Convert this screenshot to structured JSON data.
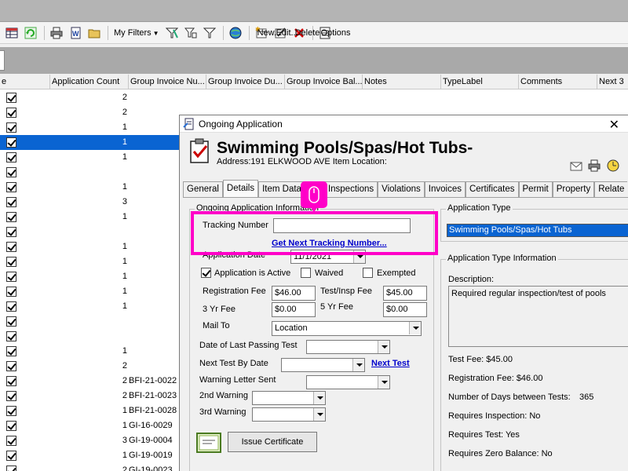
{
  "toolbar": {
    "my_filters": "My Filters",
    "new": "New...",
    "edit": "Edit...",
    "delete": "Delete",
    "options": "Options"
  },
  "grid": {
    "columns": [
      "e",
      "Application Count",
      "Group Invoice Nu...",
      "Group Invoice Du...",
      "Group Invoice Bal...",
      "Notes",
      "TypeLabel",
      "Comments",
      "Next 3"
    ],
    "rows": [
      {
        "count": "2",
        "invoice": "",
        "selected": false
      },
      {
        "count": "2",
        "invoice": "",
        "selected": false
      },
      {
        "count": "1",
        "invoice": "",
        "selected": false
      },
      {
        "count": "1",
        "invoice": "",
        "selected": true
      },
      {
        "count": "1",
        "invoice": "",
        "selected": false
      },
      {
        "count": "",
        "invoice": "",
        "selected": false
      },
      {
        "count": "1",
        "invoice": "",
        "selected": false
      },
      {
        "count": "3",
        "invoice": "",
        "selected": false
      },
      {
        "count": "1",
        "invoice": "",
        "selected": false
      },
      {
        "count": "",
        "invoice": "",
        "selected": false
      },
      {
        "count": "1",
        "invoice": "",
        "selected": false
      },
      {
        "count": "1",
        "invoice": "",
        "selected": false
      },
      {
        "count": "1",
        "invoice": "",
        "selected": false
      },
      {
        "count": "1",
        "invoice": "",
        "selected": false
      },
      {
        "count": "1",
        "invoice": "",
        "selected": false
      },
      {
        "count": "",
        "invoice": "",
        "selected": false
      },
      {
        "count": "",
        "invoice": "",
        "selected": false
      },
      {
        "count": "1",
        "invoice": "",
        "selected": false
      },
      {
        "count": "2",
        "invoice": "",
        "selected": false
      },
      {
        "count": "2",
        "invoice": "BFI-21-0022",
        "selected": false
      },
      {
        "count": "2",
        "invoice": "BFI-21-0023",
        "selected": false
      },
      {
        "count": "1",
        "invoice": "BFI-21-0028",
        "selected": false
      },
      {
        "count": "1",
        "invoice": "GI-16-0029",
        "selected": false
      },
      {
        "count": "3",
        "invoice": "GI-19-0004",
        "selected": false
      },
      {
        "count": "1",
        "invoice": "GI-19-0019",
        "selected": false
      },
      {
        "count": "2",
        "invoice": "GI-19-0023",
        "selected": false
      }
    ]
  },
  "dialog": {
    "window_title": "Ongoing Application",
    "heading": "Swimming Pools/Spas/Hot Tubs-",
    "address": "Address:191 ELKWOOD AVE Item Location:",
    "tabs": [
      "General",
      "Details",
      "Item Data",
      "",
      "Inspections",
      "Violations",
      "Invoices",
      "Certificates",
      "Permit",
      "Property",
      "Relate"
    ],
    "active_tab": "Details",
    "left_group": {
      "legend": "Ongoing Application Information",
      "tracking_number_label": "Tracking Number",
      "tracking_number_value": "",
      "get_next_tracking_link": "Get Next Tracking Number...",
      "application_date_label": "Application Date",
      "application_date_value": "11/1/2021",
      "active_label": "Application is Active",
      "waived_label": "Waived",
      "exempted_label": "Exempted",
      "registration_fee_label": "Registration Fee",
      "registration_fee_value": "$46.00",
      "test_insp_fee_label": "Test/Insp  Fee",
      "test_insp_fee_value": "$45.00",
      "three_yr_fee_label": "3 Yr Fee",
      "three_yr_fee_value": "$0.00",
      "five_yr_fee_label": "5 Yr Fee",
      "five_yr_fee_value": "$0.00",
      "mail_to_label": "Mail To",
      "mail_to_value": "Location",
      "last_passing_label": "Date of Last Passing Test",
      "next_test_label": "Next Test By Date",
      "next_test_link": "Next Test",
      "warning_sent_label": "Warning Letter Sent",
      "second_warning_label": "2nd Warning",
      "third_warning_label": "3rd Warning",
      "issue_certificate": "Issue Certificate"
    },
    "right_group": {
      "app_type_legend": "Application Type",
      "app_type_value": "Swimming Pools/Spas/Hot Tubs",
      "app_type_info_legend": "Application Type Information",
      "description_label": "Description:",
      "description_value": "Required regular inspection/test of pools",
      "test_fee": "Test Fee: $45.00",
      "registration_fee": "Registration Fee: $46.00",
      "days_between_label": "Number of Days between Tests:",
      "days_between_value": "365",
      "requires_inspection": "Requires Inspection: No",
      "requires_test": "Requires Test: Yes",
      "requires_zero_balance": "Requires Zero Balance: No"
    }
  },
  "colors": {
    "highlight": "#ff00c8",
    "selection": "#0a64d2",
    "link": "#0000cc"
  }
}
